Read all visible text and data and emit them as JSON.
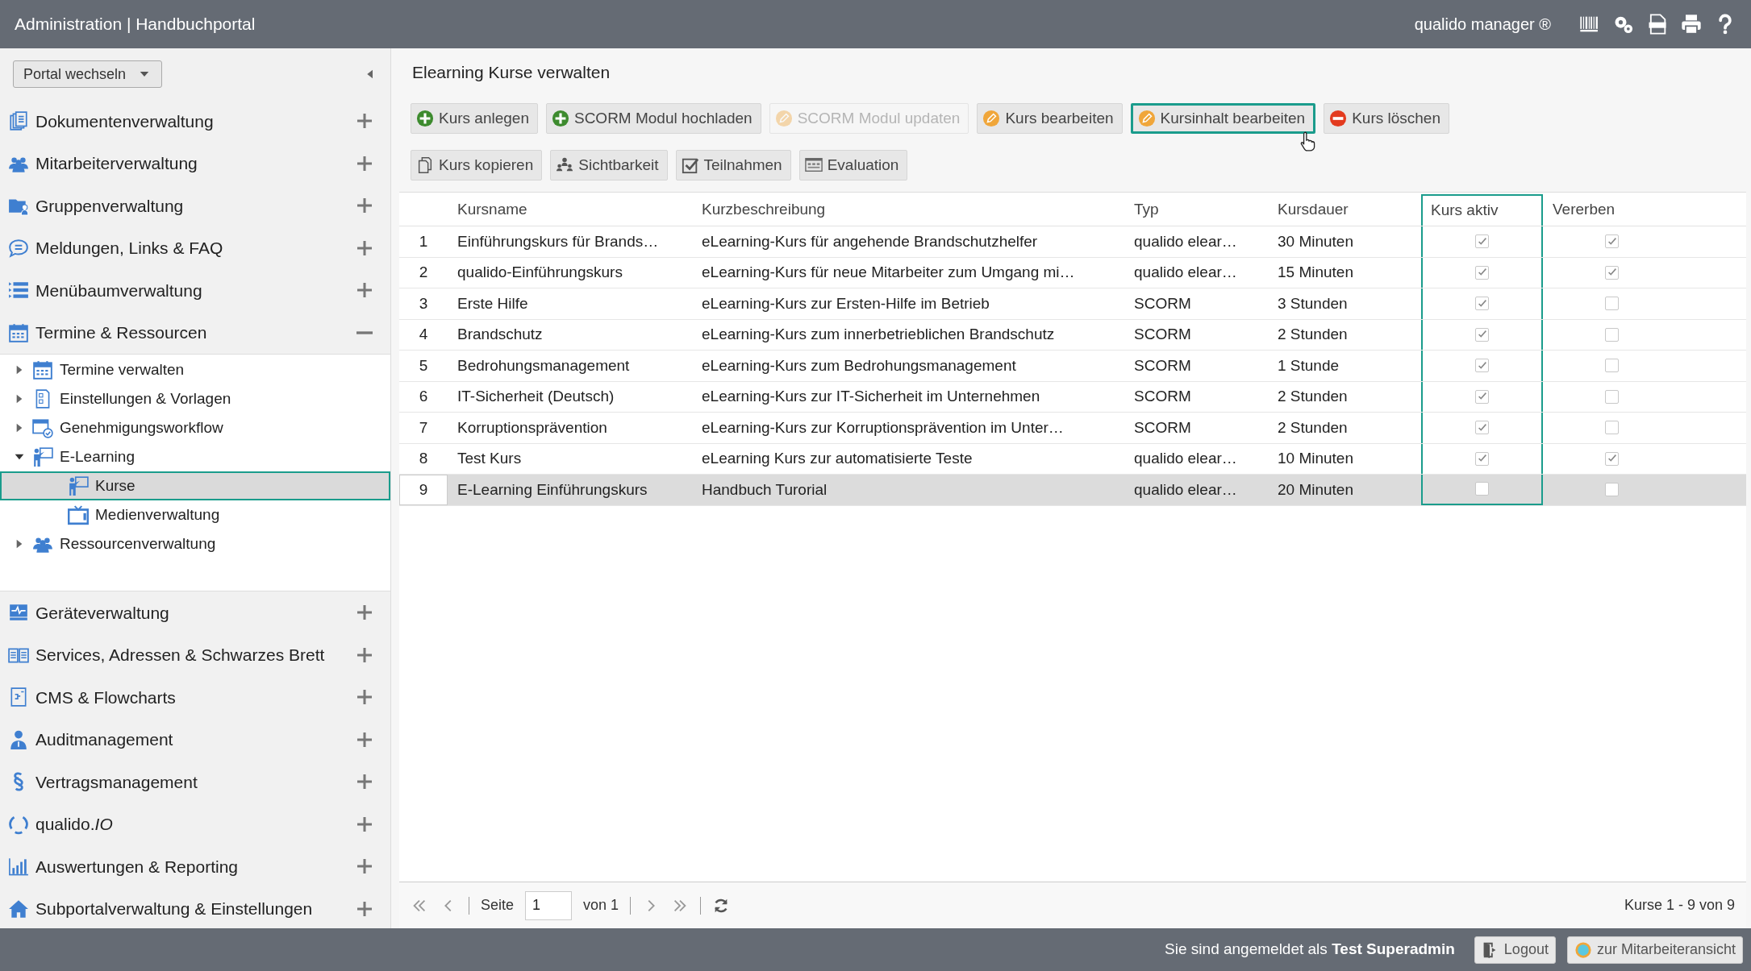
{
  "header": {
    "title": "Administration | Handbuchportal",
    "product": "qualido manager ®"
  },
  "sidebar": {
    "portal_select": "Portal wechseln",
    "sections": [
      {
        "label": "Dokumentenverwaltung",
        "expanded": false
      },
      {
        "label": "Mitarbeiterverwaltung",
        "expanded": false
      },
      {
        "label": "Gruppenverwaltung",
        "expanded": false
      },
      {
        "label": "Meldungen, Links & FAQ",
        "expanded": false
      },
      {
        "label": "Menübaumverwaltung",
        "expanded": false
      },
      {
        "label": "Termine & Ressourcen",
        "expanded": true,
        "children": [
          {
            "label": "Termine verwalten",
            "expanded": false,
            "selected": false
          },
          {
            "label": "Einstellungen & Vorlagen",
            "expanded": false,
            "selected": false
          },
          {
            "label": "Genehmigungsworkflow",
            "expanded": false,
            "selected": false
          },
          {
            "label": "E-Learning",
            "expanded": true,
            "selected": false,
            "children": [
              {
                "label": "Kurse",
                "selected": true
              },
              {
                "label": "Medienverwaltung",
                "selected": false
              }
            ]
          },
          {
            "label": "Ressourcenverwaltung",
            "expanded": false,
            "selected": false
          }
        ]
      },
      {
        "label": "Geräteverwaltung",
        "expanded": false
      },
      {
        "label": "Services, Adressen & Schwarzes Brett",
        "expanded": false
      },
      {
        "label": "CMS & Flowcharts",
        "expanded": false
      },
      {
        "label": "Auditmanagement",
        "expanded": false
      },
      {
        "label": "Vertragsmanagement",
        "expanded": false
      },
      {
        "label": "qualido.*IO*",
        "expanded": false
      },
      {
        "label": "Auswertungen & Reporting",
        "expanded": false
      },
      {
        "label": "Subportalverwaltung & Einstellungen",
        "expanded": false
      }
    ]
  },
  "page_title": "Elearning Kurse verwalten",
  "toolbar": [
    [
      {
        "label": "Kurs anlegen",
        "kind": "add",
        "disabled": false,
        "focused": false
      },
      {
        "label": "SCORM Modul hochladen",
        "kind": "add",
        "disabled": false,
        "focused": false
      },
      {
        "label": "SCORM Modul updaten",
        "kind": "edit",
        "disabled": true,
        "focused": false
      },
      {
        "label": "Kurs bearbeiten",
        "kind": "edit",
        "disabled": false,
        "focused": false
      },
      {
        "label": "Kursinhalt bearbeiten",
        "kind": "edit",
        "disabled": false,
        "focused": true
      },
      {
        "label": "Kurs löschen",
        "kind": "delete",
        "disabled": false,
        "focused": false
      }
    ],
    [
      {
        "label": "Kurs kopieren",
        "kind": "copy",
        "disabled": false,
        "focused": false
      },
      {
        "label": "Sichtbarkeit",
        "kind": "visibility",
        "disabled": false,
        "focused": false
      },
      {
        "label": "Teilnahmen",
        "kind": "participation",
        "disabled": false,
        "focused": false
      },
      {
        "label": "Evaluation",
        "kind": "evaluation",
        "disabled": false,
        "focused": false
      }
    ]
  ],
  "table": {
    "columns": [
      {
        "label": "Kursname",
        "focused": false
      },
      {
        "label": "Kurzbeschreibung",
        "focused": false
      },
      {
        "label": "Typ",
        "focused": false
      },
      {
        "label": "Kursdauer",
        "focused": false
      },
      {
        "label": "Kurs aktiv",
        "focused": true
      },
      {
        "label": "Vererben",
        "focused": false
      }
    ],
    "rows": [
      {
        "number": "1",
        "name": "Einführungskurs für Brands…",
        "description": "eLearning-Kurs für angehende Brandschutzhelfer",
        "type": "qualido elear…",
        "duration": "30 Minuten",
        "active": true,
        "inherit": true,
        "selected": false
      },
      {
        "number": "2",
        "name": "qualido-Einführungskurs",
        "description": "eLearning-Kurs für neue Mitarbeiter zum Umgang mi…",
        "type": "qualido elear…",
        "duration": "15 Minuten",
        "active": true,
        "inherit": true,
        "selected": false
      },
      {
        "number": "3",
        "name": "Erste Hilfe",
        "description": "eLearning-Kurs zur Ersten-Hilfe im Betrieb",
        "type": "SCORM",
        "duration": "3 Stunden",
        "active": true,
        "inherit": false,
        "selected": false
      },
      {
        "number": "4",
        "name": "Brandschutz",
        "description": "eLearning-Kurs zum innerbetrieblichen Brandschutz",
        "type": "SCORM",
        "duration": "2 Stunden",
        "active": true,
        "inherit": false,
        "selected": false
      },
      {
        "number": "5",
        "name": "Bedrohungsmanagement",
        "description": "eLearning-Kurs zum Bedrohungsmanagement",
        "type": "SCORM",
        "duration": "1 Stunde",
        "active": true,
        "inherit": false,
        "selected": false
      },
      {
        "number": "6",
        "name": "IT-Sicherheit (Deutsch)",
        "description": "eLearning-Kurs zur IT-Sicherheit im Unternehmen",
        "type": "SCORM",
        "duration": "2 Stunden",
        "active": true,
        "inherit": false,
        "selected": false
      },
      {
        "number": "7",
        "name": "Korruptionsprävention",
        "description": "eLearning-Kurs zur Korruptionsprävention im Unter…",
        "type": "SCORM",
        "duration": "2 Stunden",
        "active": true,
        "inherit": false,
        "selected": false
      },
      {
        "number": "8",
        "name": "Test Kurs",
        "description": "eLearning Kurs zur automatisierte Teste",
        "type": "qualido elear…",
        "duration": "10 Minuten",
        "active": true,
        "inherit": true,
        "selected": false
      },
      {
        "number": "9",
        "name": "E-Learning Einführungskurs",
        "description": "Handbuch Turorial",
        "type": "qualido elear…",
        "duration": "20 Minuten",
        "active": false,
        "inherit": false,
        "selected": true
      }
    ]
  },
  "pagination": {
    "page_label": "Seite",
    "page": "1",
    "of": "von 1",
    "summary": "Kurse 1 - 9 von 9"
  },
  "footer": {
    "login_text": "Sie sind angemeldet als **Test Superadmin**",
    "buttons": [
      {
        "label": "Logout",
        "kind": "logout"
      },
      {
        "label": "zur Mitarbeiteransicht",
        "kind": "employee_view"
      }
    ]
  }
}
